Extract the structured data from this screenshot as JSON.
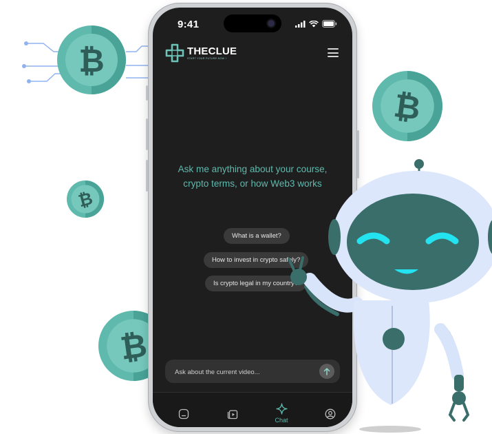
{
  "status_bar": {
    "time": "9:41"
  },
  "brand": {
    "name": "THECLUE",
    "tagline": "START YOUR FUTURE NOW !"
  },
  "header": {
    "menu_icon": "hamburger-menu-icon"
  },
  "chat": {
    "prompt": "Ask me anything about your course, crypto terms, or how Web3 works",
    "suggestions": [
      "What is a wallet?",
      "How to invest in crypto safely?",
      "Is crypto legal in my country?"
    ],
    "input": {
      "placeholder": "Ask about the current video...",
      "value": "",
      "send_icon": "arrow-up-icon"
    }
  },
  "tabbar": {
    "tabs": [
      {
        "icon": "home-icon",
        "label": ""
      },
      {
        "icon": "video-library-icon",
        "label": ""
      },
      {
        "icon": "sparkle-icon",
        "label": "Chat",
        "active": true
      },
      {
        "icon": "profile-icon",
        "label": ""
      }
    ]
  },
  "decorations": {
    "coin_icon": "bitcoin-icon",
    "mascot": "robot-mascot"
  },
  "colors": {
    "screen_bg": "#1e1e1e",
    "accent_teal": "#5fb9ad",
    "coin_teal": "#5fb9ad",
    "robot_body": "#dce7fb",
    "robot_face": "#3a6e6a",
    "robot_eyes": "#23e3f0"
  }
}
